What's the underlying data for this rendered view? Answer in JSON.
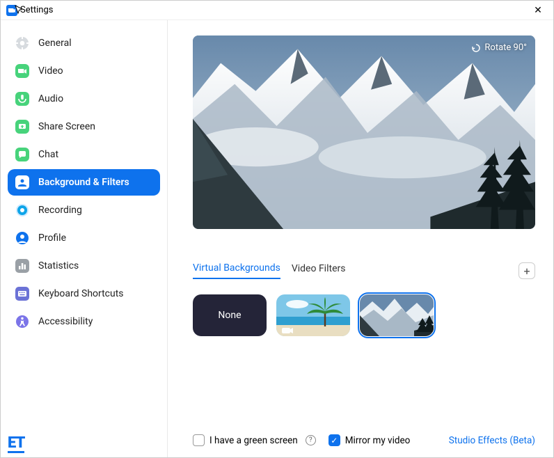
{
  "title": "Settings",
  "close_glyph": "✕",
  "sidebar": {
    "items": [
      {
        "label": "General",
        "icon": "gear-icon",
        "color": "#d0d5da"
      },
      {
        "label": "Video",
        "icon": "video-icon",
        "color": "#47d37b"
      },
      {
        "label": "Audio",
        "icon": "audio-icon",
        "color": "#47d37b"
      },
      {
        "label": "Share Screen",
        "icon": "share-screen-icon",
        "color": "#47d37b"
      },
      {
        "label": "Chat",
        "icon": "chat-icon",
        "color": "#47d37b"
      },
      {
        "label": "Background & Filters",
        "icon": "background-icon",
        "color": "#0e72ed",
        "active": true
      },
      {
        "label": "Recording",
        "icon": "recording-icon",
        "color": "#0ea5e9"
      },
      {
        "label": "Profile",
        "icon": "profile-icon",
        "color": "#0e72ed"
      },
      {
        "label": "Statistics",
        "icon": "statistics-icon",
        "color": "#6b7280"
      },
      {
        "label": "Keyboard Shortcuts",
        "icon": "keyboard-icon",
        "color": "#6b72d6"
      },
      {
        "label": "Accessibility",
        "icon": "accessibility-icon",
        "color": "#7b74e8"
      }
    ]
  },
  "preview": {
    "rotate_label": "Rotate 90°"
  },
  "tabs": [
    {
      "label": "Virtual Backgrounds",
      "active": true
    },
    {
      "label": "Video Filters",
      "active": false
    }
  ],
  "add_glyph": "+",
  "thumbs": {
    "none_label": "None"
  },
  "bottom": {
    "green_screen_label": "I have a green screen",
    "green_screen_checked": false,
    "mirror_label": "Mirror my video",
    "mirror_checked": true,
    "studio_label": "Studio Effects (Beta)",
    "help_glyph": "?"
  },
  "watermark": "ET"
}
